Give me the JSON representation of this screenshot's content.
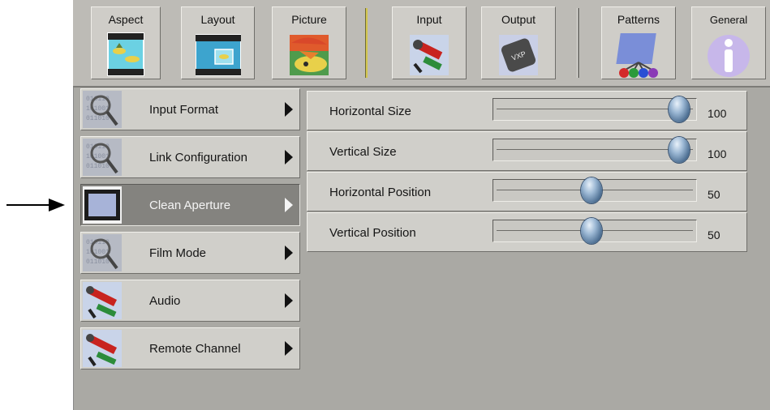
{
  "toolbar": {
    "buttons": [
      {
        "label": "Aspect",
        "icon": "aspect-icon"
      },
      {
        "label": "Layout",
        "icon": "layout-icon"
      },
      {
        "label": "Picture",
        "icon": "picture-icon"
      },
      {
        "label": "Input",
        "icon": "input-icon"
      },
      {
        "label": "Output",
        "icon": "output-icon"
      },
      {
        "label": "Patterns",
        "icon": "patterns-icon"
      },
      {
        "label": "General",
        "icon": "general-info-icon"
      }
    ]
  },
  "menu": {
    "items": [
      {
        "label": "Input Format",
        "icon": "magnifier-binary-icon",
        "active": false
      },
      {
        "label": "Link Configuration",
        "icon": "magnifier-binary-icon",
        "active": false
      },
      {
        "label": "Clean Aperture",
        "icon": "aperture-frame-icon",
        "active": true
      },
      {
        "label": "Film Mode",
        "icon": "magnifier-binary-icon",
        "active": false
      },
      {
        "label": "Audio",
        "icon": "av-connector-icon",
        "active": false
      },
      {
        "label": "Remote Channel",
        "icon": "av-connector-icon",
        "active": false
      }
    ]
  },
  "params": [
    {
      "label": "Horizontal Size",
      "value": "100",
      "fraction": 1.0
    },
    {
      "label": "Vertical Size",
      "value": "100",
      "fraction": 1.0
    },
    {
      "label": "Horizontal Position",
      "value": "50",
      "fraction": 0.5
    },
    {
      "label": "Vertical Position",
      "value": "50",
      "fraction": 0.5
    }
  ],
  "colors": {
    "panel_bg": "#aaa9a4",
    "button_face": "#d0cfca",
    "active_button": "#84837f",
    "separator_yellow": "#d3c64f",
    "knob_blue": "#4a6c90"
  }
}
